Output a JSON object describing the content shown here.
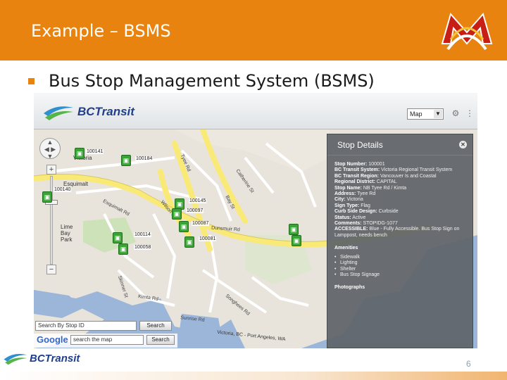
{
  "slide": {
    "title": "Example – BSMS",
    "bullet": "Bus Stop Management System (BSMS)",
    "page_number": "6",
    "footer_logo_text": "BCTransit"
  },
  "app": {
    "logo_text": "BCTransit",
    "map_type": "Map",
    "search_stop_placeholder": "Search By Stop ID",
    "search_stop_button": "Search",
    "search_map_placeholder": "search the map",
    "search_map_button": "Search",
    "google_label": "Google"
  },
  "map": {
    "places": [
      {
        "label": "Victoria"
      },
      {
        "label": "Esquimalt"
      },
      {
        "label": "Lime Bay Park"
      },
      {
        "label": "Victoria, BC - Port Angeles, WA"
      }
    ],
    "roads": [
      {
        "label": "Esquimalt Rd"
      },
      {
        "label": "Tyee Rd"
      },
      {
        "label": "Bay St"
      },
      {
        "label": "Catherine St"
      },
      {
        "label": "Kimta Rd"
      },
      {
        "label": "Skinner St"
      },
      {
        "label": "Sunrise Rd"
      },
      {
        "label": "Songhees Rd"
      },
      {
        "label": "Dunsmuir Rd"
      },
      {
        "label": "Wilson St"
      }
    ],
    "stops": [
      {
        "id": "100141"
      },
      {
        "id": "100184"
      },
      {
        "id": "100140"
      },
      {
        "id": "100145"
      },
      {
        "id": "100097"
      },
      {
        "id": "100087"
      },
      {
        "id": "100114"
      },
      {
        "id": "100058"
      },
      {
        "id": "100081"
      }
    ]
  },
  "details": {
    "title": "Stop Details",
    "fields": [
      {
        "k": "Stop Number:",
        "v": "100001"
      },
      {
        "k": "BC Transit System:",
        "v": "Victoria Regional Transit System"
      },
      {
        "k": "BC Transit Region:",
        "v": "Vancouver Is and Coastal"
      },
      {
        "k": "Regional District:",
        "v": "CAPITAL"
      },
      {
        "k": "Stop Name:",
        "v": "NB Tyee Rd / Kimta"
      },
      {
        "k": "Address:",
        "v": "Tyee Rd"
      },
      {
        "k": "City:",
        "v": "Victoria"
      },
      {
        "k": "Sign Type:",
        "v": "Flag"
      },
      {
        "k": "Curb Side Design:",
        "v": "Curbside"
      },
      {
        "k": "Status:",
        "v": "Active"
      },
      {
        "k": "Comments:",
        "v": "STOPIDG-1077"
      },
      {
        "k": "ACCESSIBLE:",
        "v": "Blue - Fully Accessible. Bus Stop Sign on Lamppost, needs bench"
      }
    ],
    "amenities_title": "Amenities",
    "amenities": [
      "Sidewalk",
      "Lighting",
      "Shelter",
      "Bus Stop Signage"
    ],
    "photographs_title": "Photographs"
  },
  "colors": {
    "accent": "#e8830f",
    "stop_green": "#3aa335",
    "road_yellow": "#f9ea78",
    "water": "#9bb6d9",
    "panel": "#5f6468"
  }
}
